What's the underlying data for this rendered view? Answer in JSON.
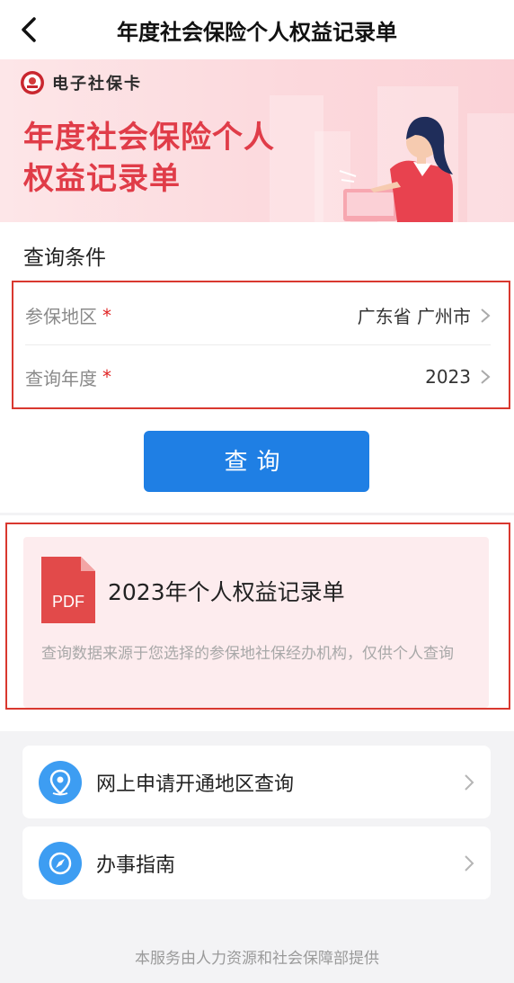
{
  "nav": {
    "title": "年度社会保险个人权益记录单",
    "back_icon": "chevron-left-icon"
  },
  "banner": {
    "brand": "电子社保卡",
    "heading_line1": "年度社会保险个人",
    "heading_line2": "权益记录单",
    "accent_color": "#e03c48"
  },
  "query": {
    "section_title": "查询条件",
    "region_label": "参保地区",
    "region_value": "广东省 广州市",
    "year_label": "查询年度",
    "year_value": "2023",
    "required_mark": "*",
    "button_label": "查询",
    "button_color": "#1f7fe4"
  },
  "result": {
    "file_icon_label": "PDF",
    "title": "2023年个人权益记录单",
    "note": "查询数据来源于您选择的参保地社保经办机构，仅供个人查询"
  },
  "links": [
    {
      "label": "网上申请开通地区查询",
      "icon": "map-pin-icon"
    },
    {
      "label": "办事指南",
      "icon": "compass-icon"
    }
  ],
  "footer": {
    "text": "本服务由人力资源和社会保障部提供"
  }
}
